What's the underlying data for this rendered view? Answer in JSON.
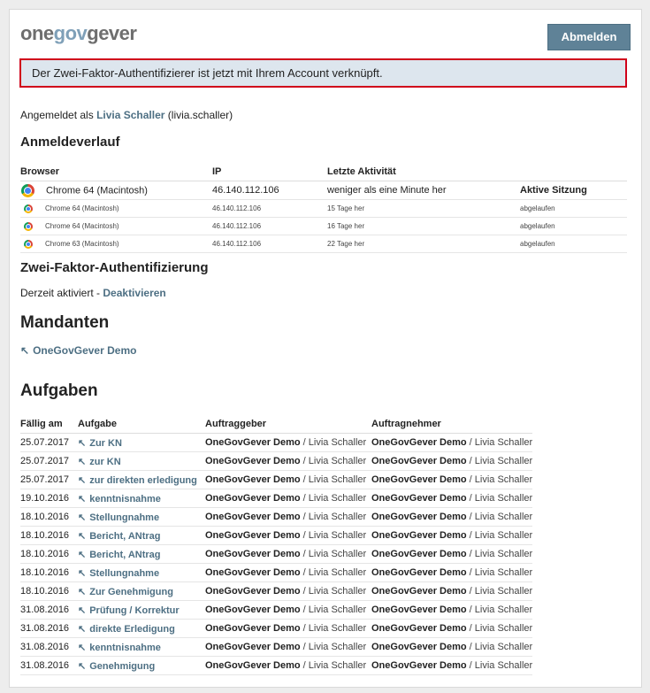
{
  "logo": {
    "part1": "one",
    "part2": "gov",
    "part3": "gever"
  },
  "logout_label": "Abmelden",
  "message": "Der Zwei-Faktor-Authentifizierer ist jetzt mit Ihrem Account verknüpft.",
  "logged_in": {
    "prefix": "Angemeldet als",
    "name": "Livia Schaller",
    "username": "(livia.schaller)"
  },
  "history": {
    "title": "Anmeldeverlauf",
    "columns": [
      "Browser",
      "IP",
      "Letzte Aktivität",
      ""
    ],
    "rows": [
      {
        "browser": "Chrome 64 (Macintosh)",
        "ip": "46.140.112.106",
        "activity": "weniger als eine Minute her",
        "status": "Aktive Sitzung"
      },
      {
        "browser": "Chrome 64 (Macintosh)",
        "ip": "46.140.112.106",
        "activity": "15 Tage her",
        "status": "abgelaufen"
      },
      {
        "browser": "Chrome 64 (Macintosh)",
        "ip": "46.140.112.106",
        "activity": "16 Tage her",
        "status": "abgelaufen"
      },
      {
        "browser": "Chrome 63 (Macintosh)",
        "ip": "46.140.112.106",
        "activity": "22 Tage her",
        "status": "abgelaufen"
      }
    ]
  },
  "two_factor": {
    "title": "Zwei-Faktor-Authentifizierung",
    "status": "Derzeit aktiviert -",
    "action": "Deaktivieren"
  },
  "mandanten": {
    "title": "Mandanten",
    "link": "OneGovGever Demo"
  },
  "tasks": {
    "title": "Aufgaben",
    "columns": [
      "Fällig am",
      "Aufgabe",
      "Auftraggeber",
      "Auftragnehmer"
    ],
    "rows": [
      {
        "due": "25.07.2017",
        "task": "Zur KN",
        "org1": "OneGovGever Demo",
        "p1": "/ Livia Schaller",
        "org2": "OneGovGever Demo",
        "p2": "/ Livia Schaller"
      },
      {
        "due": "25.07.2017",
        "task": "zur KN",
        "org1": "OneGovGever Demo",
        "p1": "/ Livia Schaller",
        "org2": "OneGovGever Demo",
        "p2": "/ Livia Schaller"
      },
      {
        "due": "25.07.2017",
        "task": "zur direkten erledigung",
        "org1": "OneGovGever Demo",
        "p1": "/ Livia Schaller",
        "org2": "OneGovGever Demo",
        "p2": "/ Livia Schaller"
      },
      {
        "due": "19.10.2016",
        "task": "kenntnisnahme",
        "org1": "OneGovGever Demo",
        "p1": "/ Livia Schaller",
        "org2": "OneGovGever Demo",
        "p2": "/ Livia Schaller"
      },
      {
        "due": "18.10.2016",
        "task": "Stellungnahme",
        "org1": "OneGovGever Demo",
        "p1": "/ Livia Schaller",
        "org2": "OneGovGever Demo",
        "p2": "/ Livia Schaller"
      },
      {
        "due": "18.10.2016",
        "task": "Bericht, ANtrag",
        "org1": "OneGovGever Demo",
        "p1": "/ Livia Schaller",
        "org2": "OneGovGever Demo",
        "p2": "/ Livia Schaller"
      },
      {
        "due": "18.10.2016",
        "task": "Bericht, ANtrag",
        "org1": "OneGovGever Demo",
        "p1": "/ Livia Schaller",
        "org2": "OneGovGever Demo",
        "p2": "/ Livia Schaller"
      },
      {
        "due": "18.10.2016",
        "task": "Stellungnahme",
        "org1": "OneGovGever Demo",
        "p1": "/ Livia Schaller",
        "org2": "OneGovGever Demo",
        "p2": "/ Livia Schaller"
      },
      {
        "due": "18.10.2016",
        "task": "Zur Genehmigung",
        "org1": "OneGovGever Demo",
        "p1": "/ Livia Schaller",
        "org2": "OneGovGever Demo",
        "p2": "/ Livia Schaller"
      },
      {
        "due": "31.08.2016",
        "task": "Prüfung / Korrektur",
        "org1": "OneGovGever Demo",
        "p1": "/ Livia Schaller",
        "org2": "OneGovGever Demo",
        "p2": "/ Livia Schaller"
      },
      {
        "due": "31.08.2016",
        "task": "direkte Erledigung",
        "org1": "OneGovGever Demo",
        "p1": "/ Livia Schaller",
        "org2": "OneGovGever Demo",
        "p2": "/ Livia Schaller"
      },
      {
        "due": "31.08.2016",
        "task": "kenntnisnahme",
        "org1": "OneGovGever Demo",
        "p1": "/ Livia Schaller",
        "org2": "OneGovGever Demo",
        "p2": "/ Livia Schaller"
      },
      {
        "due": "31.08.2016",
        "task": "Genehmigung",
        "org1": "OneGovGever Demo",
        "p1": "/ Livia Schaller",
        "org2": "OneGovGever Demo",
        "p2": "/ Livia Schaller"
      }
    ]
  }
}
